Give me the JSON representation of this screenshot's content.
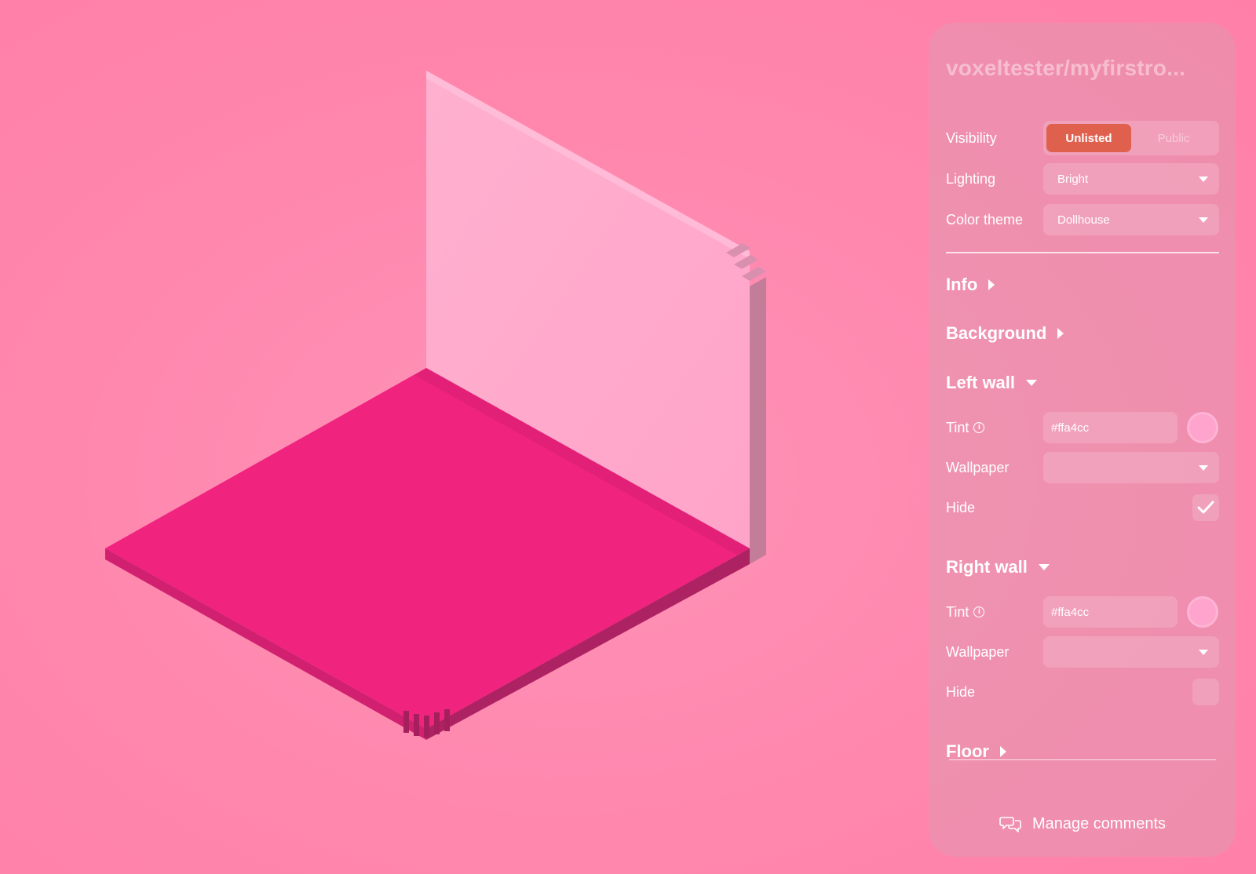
{
  "room_title": "voxeltester/myfirstro...",
  "visibility": {
    "label": "Visibility",
    "options": [
      "Unlisted",
      "Public"
    ],
    "selected": "Unlisted"
  },
  "lighting": {
    "label": "Lighting",
    "value": "Bright"
  },
  "color_theme": {
    "label": "Color theme",
    "value": "Dollhouse"
  },
  "sections": {
    "info": "Info",
    "background": "Background",
    "left_wall": "Left wall",
    "right_wall": "Right wall",
    "floor": "Floor"
  },
  "left_wall": {
    "tint_label": "Tint",
    "tint_value": "#ffa4cc",
    "wallpaper_label": "Wallpaper",
    "wallpaper_value": "",
    "hide_label": "Hide",
    "hide_checked": true
  },
  "right_wall": {
    "tint_label": "Tint",
    "tint_value": "#ffa4cc",
    "wallpaper_label": "Wallpaper",
    "wallpaper_value": "",
    "hide_label": "Hide",
    "hide_checked": false
  },
  "manage_comments": "Manage comments",
  "colors": {
    "background": "#ff86ad",
    "floor": "#f0237f",
    "wall": "#ffa4cc",
    "accent_selected": "#e0604e"
  }
}
